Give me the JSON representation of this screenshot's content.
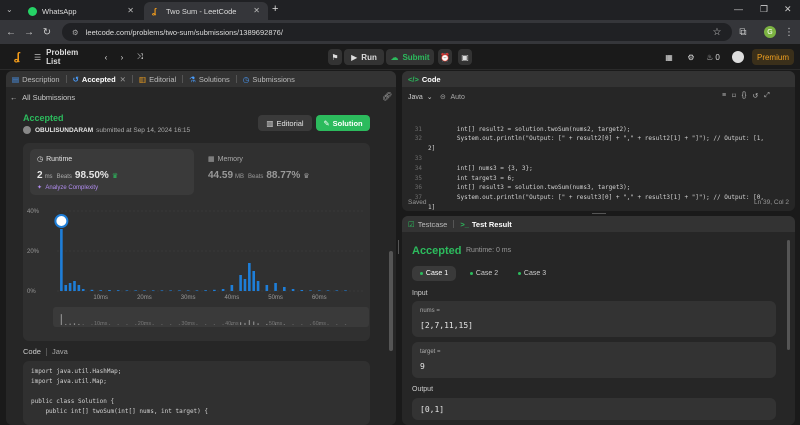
{
  "browser": {
    "tabs": [
      {
        "label": "WhatsApp",
        "active": false
      },
      {
        "label": "Two Sum - LeetCode",
        "active": true
      }
    ],
    "url": "leetcode.com/problems/two-sum/submissions/1389692876/"
  },
  "header": {
    "problem_list": "Problem List",
    "run": "Run",
    "submit": "Submit",
    "streak": "0",
    "premium": "Premium"
  },
  "left_tabs": [
    "Description",
    "Accepted",
    "Editorial",
    "Solutions",
    "Submissions"
  ],
  "back_link": "All Submissions",
  "submission": {
    "status": "Accepted",
    "user": "OBULISUNDARAM",
    "submitted_text": "submitted at Sep 14, 2024 16:15",
    "editorial_btn": "Editorial",
    "solution_btn": "Solution"
  },
  "runtime": {
    "label": "Runtime",
    "value": "2",
    "unit": "ms",
    "beats_label": "Beats",
    "beats": "98.50%",
    "analyze": "Analyze Complexity"
  },
  "memory": {
    "label": "Memory",
    "value": "44.59",
    "unit": "MB",
    "beats_label": "Beats",
    "beats": "88.77%"
  },
  "chart_data": {
    "type": "bar",
    "ytick_labels": [
      "40%",
      "20%",
      "0%"
    ],
    "xtick_labels": [
      "10ms",
      "20ms",
      "30ms",
      "40ms",
      "50ms",
      "60ms"
    ],
    "ylim": [
      0,
      40
    ],
    "x": [
      1,
      2,
      3,
      4,
      5,
      6,
      8,
      10,
      12,
      14,
      16,
      18,
      20,
      22,
      24,
      26,
      28,
      30,
      32,
      34,
      36,
      38,
      40,
      42,
      43,
      44,
      45,
      46,
      48,
      50,
      52,
      54,
      56,
      58,
      60,
      62,
      64,
      66
    ],
    "values": [
      31,
      3,
      4,
      5,
      3,
      1,
      0.6,
      0.4,
      0.5,
      0.4,
      0.3,
      0.3,
      0.3,
      0.3,
      0.3,
      0.3,
      0.3,
      0.3,
      0.3,
      0.4,
      0.6,
      1,
      3,
      8,
      6,
      14,
      10,
      5,
      3,
      4,
      2,
      1,
      0.5,
      0.3,
      0.3,
      0.3,
      0.3,
      0.3
    ],
    "highlight_index": 0
  },
  "code_section": {
    "label": "Code",
    "lang": "Java",
    "lines": [
      "import java.util.HashMap;",
      "import java.util.Map;",
      "",
      "public class Solution {",
      "    public int[] twoSum(int[] nums, int target) {"
    ]
  },
  "editor": {
    "title": "Code",
    "language": "Java",
    "mode": "Auto",
    "line_numbers": [
      "31",
      "32",
      "",
      "33",
      "34",
      "35",
      "36",
      "37",
      ""
    ],
    "lines": [
      "        int[] result2 = solution.twoSum(nums2, target2);",
      "        System.out.println(\"Output: [\" + result2[0] + \",\" + result2[1] + \"]\"); // Output: [1,",
      "2]",
      "",
      "        int[] nums3 = {3, 3};",
      "        int target3 = 6;",
      "        int[] result3 = solution.twoSum(nums3, target3);",
      "        System.out.println(\"Output: [\" + result3[0] + \",\" + result3[1] + \"]\"); // Output: [0,",
      "1]"
    ],
    "saved": "Saved",
    "cursor": "Ln 39, Col 2"
  },
  "test_panel": {
    "tab_testcase": "Testcase",
    "tab_result": "Test Result",
    "status": "Accepted",
    "runtime": "Runtime: 0 ms",
    "cases": [
      "Case 1",
      "Case 2",
      "Case 3"
    ],
    "input_label": "Input",
    "nums_label": "nums =",
    "nums_value": "[2,7,11,15]",
    "target_label": "target =",
    "target_value": "9",
    "output_label": "Output",
    "output_value": "[0,1]"
  },
  "colors": {
    "accent_green": "#2cbb5d",
    "bar_blue": "#1e7ed8",
    "premium": "#f0a020"
  }
}
